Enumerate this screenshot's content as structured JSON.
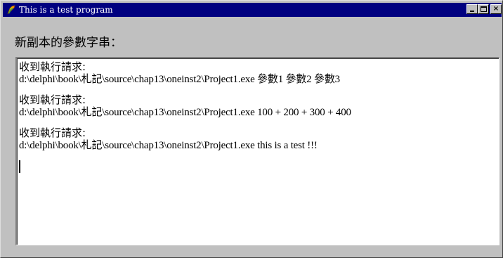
{
  "window": {
    "title": "This is a test program",
    "title_bar_color": "#000080",
    "app_icon": "delphi-app-icon",
    "controls": {
      "minimize_icon": "minimize-icon",
      "maximize_icon": "maximize-icon",
      "close_label": "×",
      "close_icon": "close-icon"
    }
  },
  "label": {
    "text": "新副本的參數字串："
  },
  "memo": {
    "entries": [
      {
        "heading": "收到執行請求:",
        "command": "d:\\delphi\\book\\札記\\source\\chap13\\oneinst2\\Project1.exe 參數1 參數2 參數3"
      },
      {
        "heading": "收到執行請求:",
        "command": "d:\\delphi\\book\\札記\\source\\chap13\\oneinst2\\Project1.exe 100 + 200 + 300 + 400"
      },
      {
        "heading": "收到執行請求:",
        "command": "d:\\delphi\\book\\札記\\source\\chap13\\oneinst2\\Project1.exe this is a test !!!"
      }
    ]
  }
}
